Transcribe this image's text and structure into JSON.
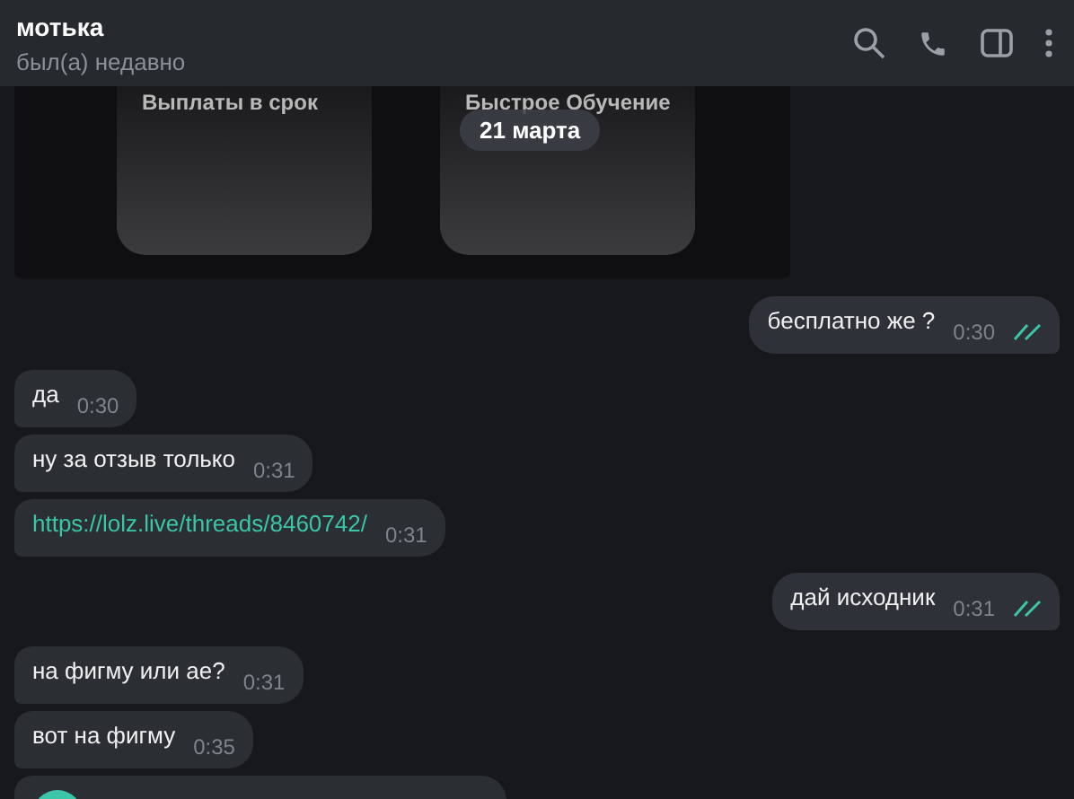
{
  "header": {
    "title": "мотька",
    "status": "был(а) недавно"
  },
  "image_message": {
    "cards": [
      {
        "title": "Выплаты в срок"
      },
      {
        "title": "Быстрое Обучение"
      }
    ]
  },
  "date_pill": "21 марта",
  "messages": [
    {
      "outgoing": true,
      "kind": "text",
      "text": "бесплатно же ?",
      "time": "0:30",
      "read": true
    },
    {
      "outgoing": false,
      "kind": "text",
      "text": "да",
      "time": "0:30"
    },
    {
      "outgoing": false,
      "kind": "text",
      "text": "ну за отзыв только",
      "time": "0:31"
    },
    {
      "outgoing": false,
      "kind": "link",
      "text": "https://lolz.live/threads/8460742/",
      "time": "0:31"
    },
    {
      "outgoing": true,
      "kind": "text",
      "text": "дай исходник",
      "time": "0:31",
      "read": true
    },
    {
      "outgoing": false,
      "kind": "text",
      "text": "на фигму или ае?",
      "time": "0:31"
    },
    {
      "outgoing": false,
      "kind": "text",
      "text": "вот на фигму",
      "time": "0:35"
    },
    {
      "outgoing": false,
      "kind": "attachment"
    }
  ]
}
